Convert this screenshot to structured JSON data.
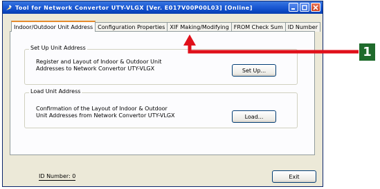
{
  "window": {
    "title": "Tool for Network Convertor UTY-VLGX [Ver. E017V00P00L03] [Online]",
    "buttons": [
      "minimize",
      "maximize",
      "close"
    ]
  },
  "tabs": [
    {
      "label": "Indoor/Outdoor Unit Address",
      "active": true
    },
    {
      "label": "Configuration Properties",
      "active": false
    },
    {
      "label": "XIF Making/Modifying",
      "active": false
    },
    {
      "label": "FROM Check Sum",
      "active": false
    },
    {
      "label": "ID Number",
      "active": false
    }
  ],
  "setup_group": {
    "title": "Set Up Unit Address",
    "description": "Register and Layout of Indoor & Outdoor Unit\nAddresses to Network Convertor UTY-VLGX",
    "button": "Set Up..."
  },
  "load_group": {
    "title": "Load Unit Address",
    "description": "Confirmation of the Layout of Indoor & Outdoor\nUnit Addresses from Network Convertor UTY-VLGX",
    "button": "Load..."
  },
  "footer": {
    "id_number": "ID Number:  0",
    "exit_button": "Exit"
  },
  "callout": {
    "label": "1",
    "color": "#e0101a",
    "badge_color": "#1f6b2c"
  }
}
